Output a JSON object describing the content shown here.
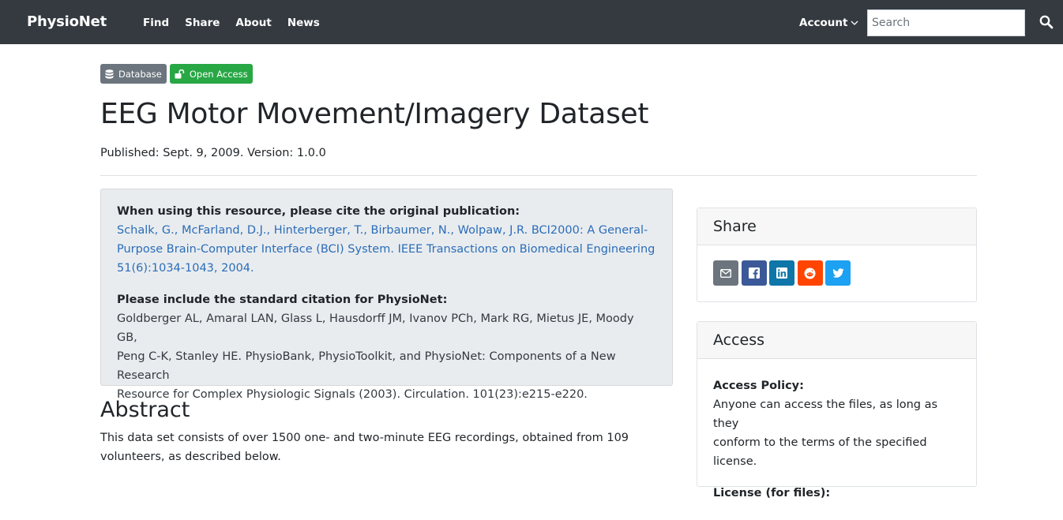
{
  "nav": {
    "brand": "PhysioNet",
    "links": [
      "Find",
      "Share",
      "About",
      "News"
    ],
    "account": "Account",
    "search_placeholder": "Search"
  },
  "badges": {
    "database": "Database",
    "open_access": "Open Access"
  },
  "project": {
    "title": "EEG Motor Movement/Imagery Dataset",
    "published": "Published: Sept. 9, 2009. Version: 1.0.0"
  },
  "citation": {
    "original_lead": "When using this resource, please cite the original publication:",
    "original_lines": [
      "Schalk, G., McFarland, D.J., Hinterberger, T., Birbaumer, N., Wolpaw, J.R. BCI2000: A General-",
      "Purpose Brain-Computer Interface (BCI) System. IEEE Transactions on Biomedical Engineering",
      "51(6):1034-1043, 2004."
    ],
    "standard_lead": "Please include the standard citation for PhysioNet:",
    "standard_lines": [
      "Goldberger AL, Amaral LAN, Glass L, Hausdorff JM, Ivanov PCh, Mark RG, Mietus JE, Moody GB,",
      "Peng C-K, Stanley HE. PhysioBank, PhysioToolkit, and PhysioNet: Components of a New Research",
      "Resource for Complex Physiologic Signals (2003). Circulation. 101(23):e215-e220."
    ]
  },
  "abstract": {
    "heading": "Abstract",
    "lines": [
      "This data set consists of over 1500 one- and two-minute EEG recordings, obtained from 109",
      "volunteers, as described below."
    ]
  },
  "share": {
    "heading": "Share",
    "buttons": [
      {
        "icon": "email-icon",
        "color": "#6c757d"
      },
      {
        "icon": "facebook-icon",
        "color": "#3b5998"
      },
      {
        "icon": "linkedin-icon",
        "color": "#0e76a8"
      },
      {
        "icon": "reddit-icon",
        "color": "#ff4500"
      },
      {
        "icon": "twitter-icon",
        "color": "#1da1f2"
      }
    ]
  },
  "access": {
    "heading": "Access",
    "policy_label": "Access Policy:",
    "policy_lines": [
      "Anyone can access the files, as long as they",
      "conform to the terms of the specified",
      "license."
    ],
    "license_label": "License (for files):"
  },
  "colors": {
    "navbar": "#343a40",
    "badge_database": "#6c757d",
    "badge_open_access": "#28a745",
    "link": "#2a6db8",
    "cite_box": "#e9ecef"
  }
}
